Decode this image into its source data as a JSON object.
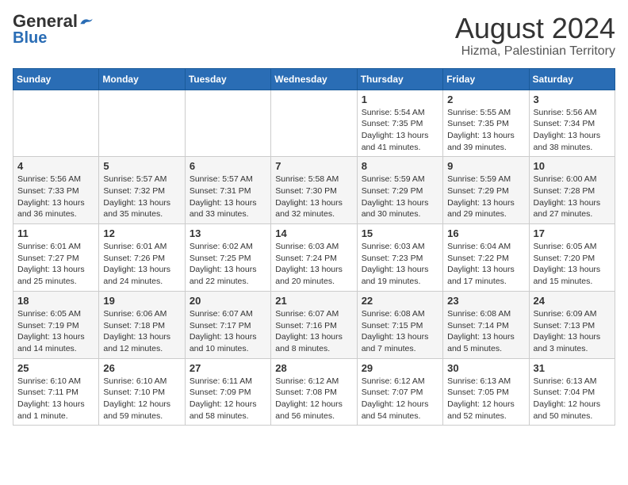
{
  "header": {
    "logo_general": "General",
    "logo_blue": "Blue",
    "month_title": "August 2024",
    "location": "Hizma, Palestinian Territory"
  },
  "days_of_week": [
    "Sunday",
    "Monday",
    "Tuesday",
    "Wednesday",
    "Thursday",
    "Friday",
    "Saturday"
  ],
  "weeks": [
    [
      {
        "day": "",
        "info": ""
      },
      {
        "day": "",
        "info": ""
      },
      {
        "day": "",
        "info": ""
      },
      {
        "day": "",
        "info": ""
      },
      {
        "day": "1",
        "info": "Sunrise: 5:54 AM\nSunset: 7:35 PM\nDaylight: 13 hours\nand 41 minutes."
      },
      {
        "day": "2",
        "info": "Sunrise: 5:55 AM\nSunset: 7:35 PM\nDaylight: 13 hours\nand 39 minutes."
      },
      {
        "day": "3",
        "info": "Sunrise: 5:56 AM\nSunset: 7:34 PM\nDaylight: 13 hours\nand 38 minutes."
      }
    ],
    [
      {
        "day": "4",
        "info": "Sunrise: 5:56 AM\nSunset: 7:33 PM\nDaylight: 13 hours\nand 36 minutes."
      },
      {
        "day": "5",
        "info": "Sunrise: 5:57 AM\nSunset: 7:32 PM\nDaylight: 13 hours\nand 35 minutes."
      },
      {
        "day": "6",
        "info": "Sunrise: 5:57 AM\nSunset: 7:31 PM\nDaylight: 13 hours\nand 33 minutes."
      },
      {
        "day": "7",
        "info": "Sunrise: 5:58 AM\nSunset: 7:30 PM\nDaylight: 13 hours\nand 32 minutes."
      },
      {
        "day": "8",
        "info": "Sunrise: 5:59 AM\nSunset: 7:29 PM\nDaylight: 13 hours\nand 30 minutes."
      },
      {
        "day": "9",
        "info": "Sunrise: 5:59 AM\nSunset: 7:29 PM\nDaylight: 13 hours\nand 29 minutes."
      },
      {
        "day": "10",
        "info": "Sunrise: 6:00 AM\nSunset: 7:28 PM\nDaylight: 13 hours\nand 27 minutes."
      }
    ],
    [
      {
        "day": "11",
        "info": "Sunrise: 6:01 AM\nSunset: 7:27 PM\nDaylight: 13 hours\nand 25 minutes."
      },
      {
        "day": "12",
        "info": "Sunrise: 6:01 AM\nSunset: 7:26 PM\nDaylight: 13 hours\nand 24 minutes."
      },
      {
        "day": "13",
        "info": "Sunrise: 6:02 AM\nSunset: 7:25 PM\nDaylight: 13 hours\nand 22 minutes."
      },
      {
        "day": "14",
        "info": "Sunrise: 6:03 AM\nSunset: 7:24 PM\nDaylight: 13 hours\nand 20 minutes."
      },
      {
        "day": "15",
        "info": "Sunrise: 6:03 AM\nSunset: 7:23 PM\nDaylight: 13 hours\nand 19 minutes."
      },
      {
        "day": "16",
        "info": "Sunrise: 6:04 AM\nSunset: 7:22 PM\nDaylight: 13 hours\nand 17 minutes."
      },
      {
        "day": "17",
        "info": "Sunrise: 6:05 AM\nSunset: 7:20 PM\nDaylight: 13 hours\nand 15 minutes."
      }
    ],
    [
      {
        "day": "18",
        "info": "Sunrise: 6:05 AM\nSunset: 7:19 PM\nDaylight: 13 hours\nand 14 minutes."
      },
      {
        "day": "19",
        "info": "Sunrise: 6:06 AM\nSunset: 7:18 PM\nDaylight: 13 hours\nand 12 minutes."
      },
      {
        "day": "20",
        "info": "Sunrise: 6:07 AM\nSunset: 7:17 PM\nDaylight: 13 hours\nand 10 minutes."
      },
      {
        "day": "21",
        "info": "Sunrise: 6:07 AM\nSunset: 7:16 PM\nDaylight: 13 hours\nand 8 minutes."
      },
      {
        "day": "22",
        "info": "Sunrise: 6:08 AM\nSunset: 7:15 PM\nDaylight: 13 hours\nand 7 minutes."
      },
      {
        "day": "23",
        "info": "Sunrise: 6:08 AM\nSunset: 7:14 PM\nDaylight: 13 hours\nand 5 minutes."
      },
      {
        "day": "24",
        "info": "Sunrise: 6:09 AM\nSunset: 7:13 PM\nDaylight: 13 hours\nand 3 minutes."
      }
    ],
    [
      {
        "day": "25",
        "info": "Sunrise: 6:10 AM\nSunset: 7:11 PM\nDaylight: 13 hours\nand 1 minute."
      },
      {
        "day": "26",
        "info": "Sunrise: 6:10 AM\nSunset: 7:10 PM\nDaylight: 12 hours\nand 59 minutes."
      },
      {
        "day": "27",
        "info": "Sunrise: 6:11 AM\nSunset: 7:09 PM\nDaylight: 12 hours\nand 58 minutes."
      },
      {
        "day": "28",
        "info": "Sunrise: 6:12 AM\nSunset: 7:08 PM\nDaylight: 12 hours\nand 56 minutes."
      },
      {
        "day": "29",
        "info": "Sunrise: 6:12 AM\nSunset: 7:07 PM\nDaylight: 12 hours\nand 54 minutes."
      },
      {
        "day": "30",
        "info": "Sunrise: 6:13 AM\nSunset: 7:05 PM\nDaylight: 12 hours\nand 52 minutes."
      },
      {
        "day": "31",
        "info": "Sunrise: 6:13 AM\nSunset: 7:04 PM\nDaylight: 12 hours\nand 50 minutes."
      }
    ]
  ]
}
